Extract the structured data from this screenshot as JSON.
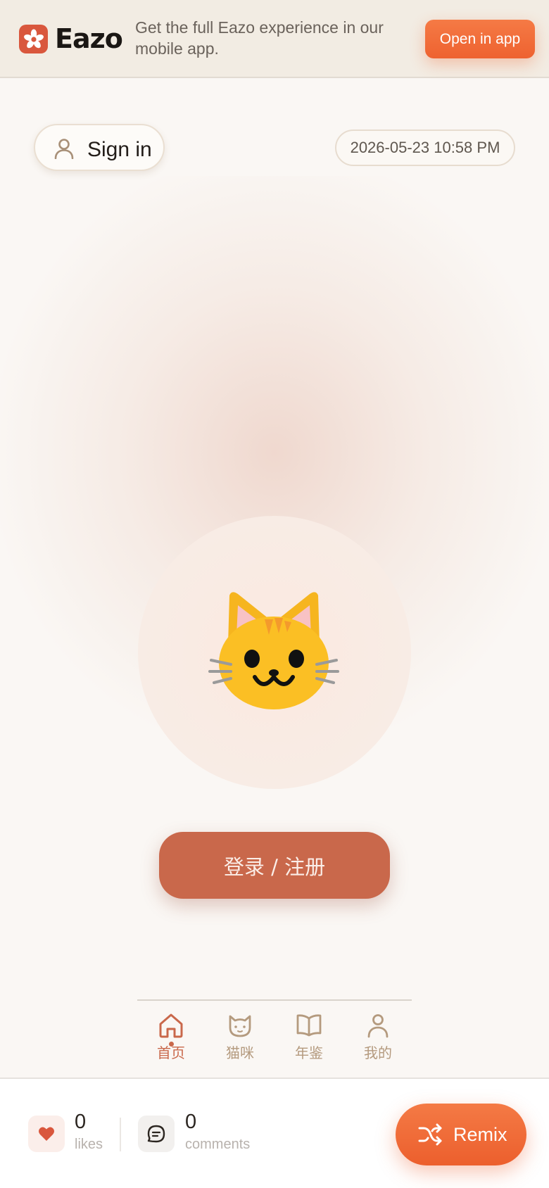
{
  "banner": {
    "logo_text": "Eazo",
    "message": "Get the full Eazo experience in our mobile app.",
    "open_app_label": "Open in app",
    "accent": "#ee6230"
  },
  "header": {
    "sign_in_label": "Sign in",
    "timestamp": "2026-05-23 10:58 PM"
  },
  "hero": {
    "emoji_name": "smiling-cat-face",
    "login_button_label": "登录 / 注册",
    "button_color": "#c9684b"
  },
  "tabs": [
    {
      "label": "首页",
      "icon": "home-icon",
      "active": true
    },
    {
      "label": "猫咪",
      "icon": "cat-icon",
      "active": false
    },
    {
      "label": "年鉴",
      "icon": "book-icon",
      "active": false
    },
    {
      "label": "我的",
      "icon": "user-icon",
      "active": false
    }
  ],
  "footer": {
    "likes_count": "0",
    "likes_label": "likes",
    "comments_count": "0",
    "comments_label": "comments",
    "remix_label": "Remix"
  }
}
